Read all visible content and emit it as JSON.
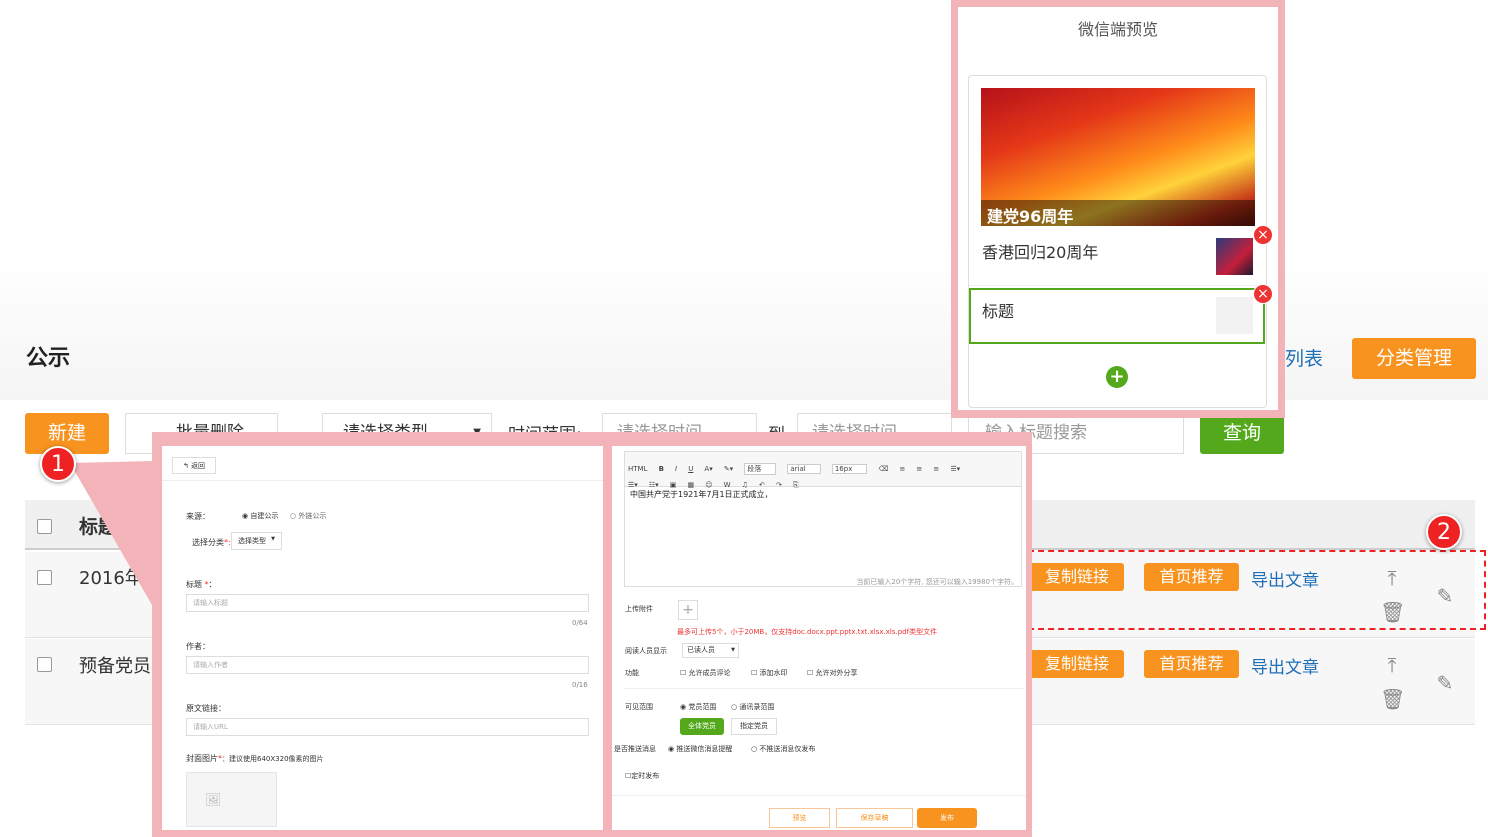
{
  "page": {
    "title": "公示"
  },
  "header_buttons": {
    "list_partial": "列表",
    "category": "分类管理"
  },
  "toolbar": {
    "new": "新建",
    "batch_delete": "批量删除",
    "type_select": "请选择类型",
    "time_range_label": "时间范围:",
    "time_start": "请选择时间",
    "to": "到",
    "time_end": "请选择时间",
    "search_placeholder": "输入标题搜索",
    "query": "查询"
  },
  "table": {
    "header_title": "标题",
    "rows": [
      {
        "title": "2016年",
        "actions": [
          "复制链接",
          "首页推荐",
          "导出文章"
        ]
      },
      {
        "title": "预备党员",
        "actions": [
          "复制链接",
          "首页推荐",
          "导出文章"
        ]
      }
    ]
  },
  "callouts": [
    "1",
    "2"
  ],
  "form": {
    "back": "返回",
    "source_label": "来源：",
    "source_opt1": "自建公示",
    "source_opt2": "外链公示",
    "category_label": "选择分类",
    "category_required": "*:",
    "category_value": "选择类型",
    "title_label": "标题",
    "title_placeholder": "请输入标题",
    "title_count": "0/64",
    "author_label": "作者：",
    "author_placeholder": "请输入作者",
    "author_count": "0/16",
    "url_label": "原文链接：",
    "url_placeholder": "请输入URL",
    "cover_label": "封面图片",
    "cover_hint": "：建议使用640X320像素的图片"
  },
  "editor": {
    "toolbar_paragraph": "段落",
    "toolbar_font": "arial",
    "toolbar_size": "16px",
    "content": "中国共产党于1921年7月1日正式成立，",
    "char_count": "当前已输入20个字符, 您还可以输入19980个字符。",
    "attach_label": "上传附件",
    "attach_hint": "最多可上传5个，小于20MB，仅支持doc.docx.ppt.pptx.txt.xlsx.xls.pdf类型文件",
    "reader_label": "阅读人员显示",
    "reader_value": "已读人员",
    "func_label": "功能",
    "func_opt1": "允许成员评论",
    "func_opt2": "添加水印",
    "func_opt3": "允许对外分享",
    "scope_label": "可见范围",
    "scope_opt1": "党员范围",
    "scope_opt2": "通讯录范围",
    "scope_all": "全体党员",
    "scope_assign": "指定党员",
    "push_label": "是否推送消息",
    "push_opt1": "推送微信消息提醒",
    "push_opt2": "不推送消息仅发布",
    "timed_label": "定时发布",
    "btn_preview": "预览",
    "btn_draft": "保存草稿",
    "btn_publish": "发布"
  },
  "preview": {
    "title": "微信端预览",
    "banner_caption": "建党96周年",
    "item1": "香港回归20周年",
    "item2": "标题"
  },
  "colors": {
    "accent_orange": "#f7931e",
    "accent_green": "#53a91b",
    "callout_red": "#e22",
    "highlight_pink": "#f2b4b9"
  }
}
